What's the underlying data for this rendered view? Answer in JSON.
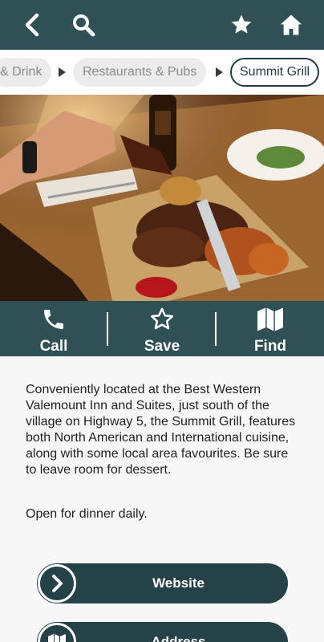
{
  "header": {
    "back_icon": "back-arrow-icon",
    "search_icon": "search-icon",
    "favorite_icon": "star-icon",
    "home_icon": "home-icon"
  },
  "breadcrumb": {
    "items": [
      {
        "label": "& Drink"
      },
      {
        "label": "Restaurants & Pubs"
      },
      {
        "label": "Summit Grill"
      }
    ]
  },
  "hero": {
    "alt_icon": "restaurant-photo"
  },
  "actions": {
    "call_label": "Call",
    "save_label": "Save",
    "find_label": "Find"
  },
  "content": {
    "description": "Conveniently located at the Best Western Valemount Inn and Suites, just south of the village on Highway 5, the Summit Grill, features both North American and International cuisine, along with some local area favourites. Be sure to leave room for dessert.",
    "hours": "Open for dinner daily."
  },
  "links": {
    "website_label": "Website",
    "address_label": "Address"
  },
  "colors": {
    "primary": "#2f5055",
    "button": "#254248",
    "active_crumb_border": "#1f3d42"
  }
}
